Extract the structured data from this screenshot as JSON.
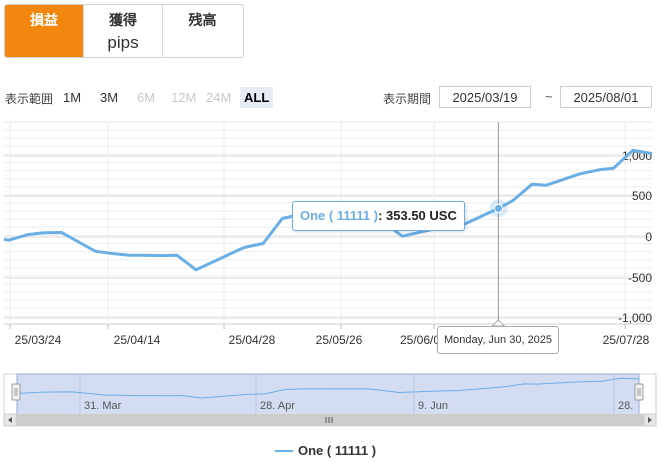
{
  "tabs": [
    {
      "label": "損益",
      "sub": "",
      "active": true
    },
    {
      "label": "獲得",
      "sub": "pips",
      "active": false
    },
    {
      "label": "残高",
      "sub": "",
      "active": false
    }
  ],
  "range": {
    "label": "表示範囲",
    "buttons": [
      {
        "label": "1M",
        "state": "normal"
      },
      {
        "label": "3M",
        "state": "normal"
      },
      {
        "label": "6M",
        "state": "disabled"
      },
      {
        "label": "12M",
        "state": "disabled"
      },
      {
        "label": "24M",
        "state": "disabled"
      },
      {
        "label": "ALL",
        "state": "selected"
      }
    ]
  },
  "period": {
    "label": "表示期間",
    "from": "2025/03/19",
    "separator": "~",
    "to": "2025/08/01"
  },
  "tooltip": {
    "series": "One ( 11111 )",
    "sep": ": ",
    "value": "353.50 USC"
  },
  "crosshair_label": "Monday, Jun 30, 2025",
  "legend": {
    "label": "One ( 11111 )"
  },
  "navigator": {
    "labels": [
      "31. Mar",
      "28. Apr",
      "9. Jun",
      "28."
    ]
  },
  "colors": {
    "accent": "#f2860f",
    "series": "#6aaee6",
    "navigator_fill": "#cdd6ef"
  },
  "chart_data": {
    "type": "line",
    "y_tick_labels": [
      "1,000",
      "500",
      "0",
      "-500",
      "-1,000"
    ],
    "ylim": [
      -1050,
      1200
    ],
    "x_tick_labels": [
      "25/03/24",
      "25/04/14",
      "25/04/28",
      "25/05/26",
      "25/06/0",
      "25/07/28"
    ],
    "grid": true,
    "series": [
      {
        "name": "One ( 11111 )",
        "points": [
          [
            "2025-03-19",
            -30
          ],
          [
            "2025-03-20",
            -40
          ],
          [
            "2025-03-24",
            30
          ],
          [
            "2025-03-27",
            50
          ],
          [
            "2025-03-31",
            55
          ],
          [
            "2025-04-07",
            -175
          ],
          [
            "2025-04-10",
            -200
          ],
          [
            "2025-04-14",
            -225
          ],
          [
            "2025-04-17",
            -225
          ],
          [
            "2025-04-21",
            -230
          ],
          [
            "2025-04-24",
            -225
          ],
          [
            "2025-04-28",
            -405
          ],
          [
            "2025-05-08",
            -130
          ],
          [
            "2025-05-12",
            -80
          ],
          [
            "2025-05-16",
            230
          ],
          [
            "2025-05-20",
            280
          ],
          [
            "2025-06-03",
            290
          ],
          [
            "2025-06-06",
            180
          ],
          [
            "2025-06-10",
            10
          ],
          [
            "2025-06-16",
            90
          ],
          [
            "2025-06-23",
            160
          ],
          [
            "2025-06-30",
            353.5
          ],
          [
            "2025-07-03",
            450
          ],
          [
            "2025-07-07",
            650
          ],
          [
            "2025-07-10",
            640
          ],
          [
            "2025-07-17",
            780
          ],
          [
            "2025-07-21",
            830
          ],
          [
            "2025-07-24",
            850
          ],
          [
            "2025-07-28",
            1070
          ],
          [
            "2025-08-01",
            1030
          ]
        ]
      }
    ],
    "highlight": {
      "date": "2025-06-30",
      "value": 353.5
    }
  }
}
